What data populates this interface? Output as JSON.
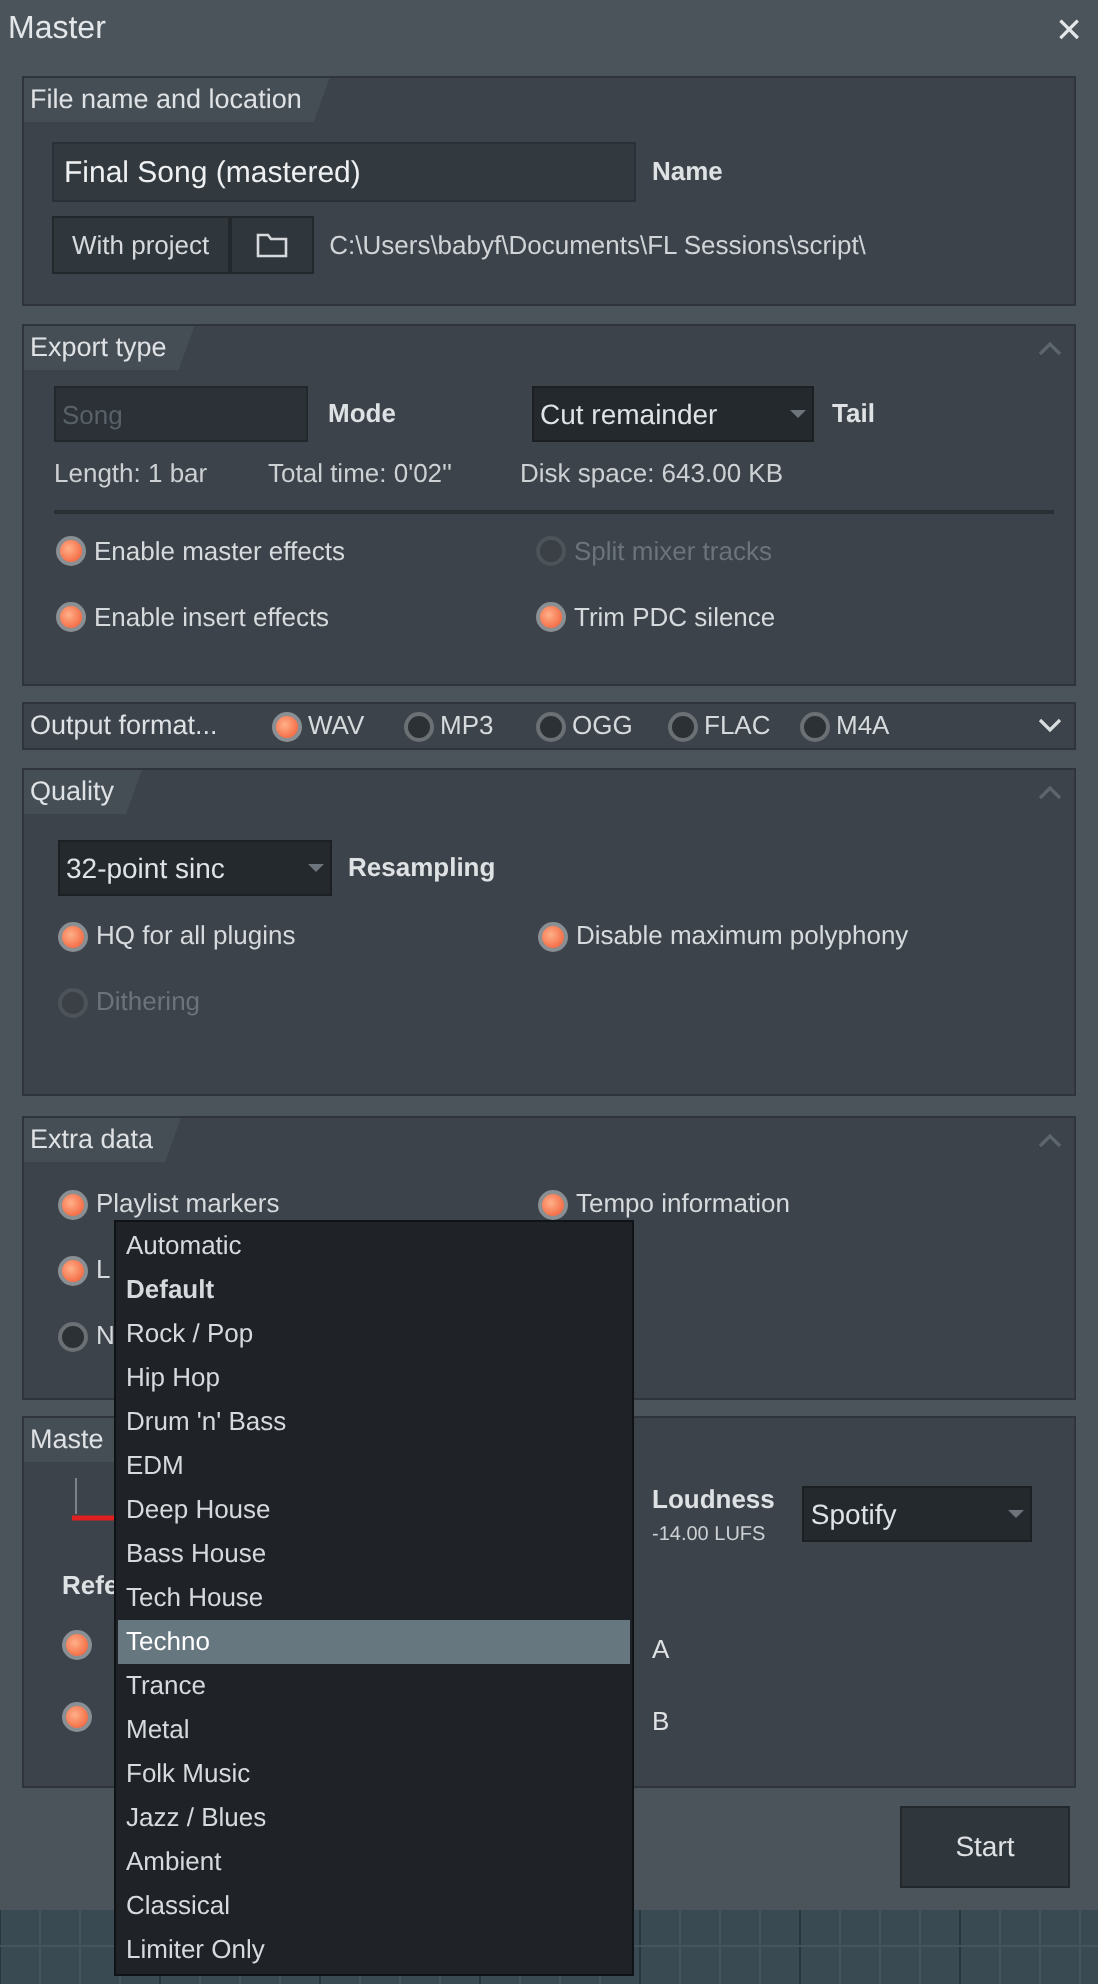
{
  "window": {
    "title": "Master",
    "close": "×"
  },
  "file_location": {
    "title": "File name and location",
    "name_value": "Final Song (mastered)",
    "name_label": "Name",
    "with_project": "With project",
    "path": "C:\\Users\\babyf\\Documents\\FL Sessions\\script\\"
  },
  "export_type": {
    "title": "Export type",
    "expanded": true,
    "mode_value": "Song",
    "mode_disabled": true,
    "mode_label": "Mode",
    "tail_value": "Cut remainder",
    "tail_label": "Tail",
    "stats": [
      "Length: 1 bar",
      "Total time: 0'02''",
      "Disk space: 643.00 KB"
    ],
    "rows": [
      [
        {
          "label": "Enable master effects",
          "checked": true,
          "disabled": false
        },
        {
          "label": "Split mixer tracks",
          "checked": false,
          "disabled": true
        }
      ],
      [
        {
          "label": "Enable insert effects",
          "checked": true,
          "disabled": false
        },
        {
          "label": "Trim PDC silence",
          "checked": true,
          "disabled": false
        }
      ]
    ]
  },
  "output_format": {
    "title": "Output format...",
    "expanded": false,
    "options": [
      {
        "label": "WAV",
        "selected": true
      },
      {
        "label": "MP3",
        "selected": false
      },
      {
        "label": "OGG",
        "selected": false
      },
      {
        "label": "FLAC",
        "selected": false
      },
      {
        "label": "M4A",
        "selected": false
      }
    ]
  },
  "quality": {
    "title": "Quality",
    "expanded": true,
    "resampling_value": "32-point sinc",
    "resampling_label": "Resampling",
    "rows": [
      [
        {
          "label": "HQ for all plugins",
          "checked": true,
          "disabled": false
        },
        {
          "label": "Disable maximum polyphony",
          "checked": true,
          "disabled": false
        }
      ],
      [
        {
          "label": "Dithering",
          "checked": false,
          "disabled": true
        }
      ]
    ]
  },
  "extra_data": {
    "title": "Extra data",
    "expanded": true,
    "rows": [
      [
        {
          "label": "Playlist markers",
          "checked": true,
          "disabled": false
        },
        {
          "label": "Tempo information",
          "checked": true,
          "disabled": false
        }
      ],
      [
        {
          "label": "L",
          "checked": true,
          "disabled": false
        }
      ],
      [
        {
          "label": "N",
          "checked": false,
          "disabled": false
        }
      ]
    ]
  },
  "mastering": {
    "title": "Maste",
    "loudness_label": "Loudness",
    "loudness_value": "-14.00 LUFS",
    "platform": "Spotify",
    "reference_label": "Refe",
    "references": [
      {
        "label": "A",
        "checked": true
      },
      {
        "label": "B",
        "checked": true
      }
    ]
  },
  "start_button": "Start",
  "preset_menu": {
    "items": [
      {
        "label": "Automatic",
        "kind": "normal",
        "selected": false
      },
      {
        "label": "Default",
        "kind": "default",
        "selected": false
      },
      {
        "label": "Rock / Pop",
        "kind": "normal",
        "selected": false
      },
      {
        "label": "Hip Hop",
        "kind": "normal",
        "selected": false
      },
      {
        "label": "Drum 'n' Bass",
        "kind": "normal",
        "selected": false
      },
      {
        "label": "EDM",
        "kind": "normal",
        "selected": false
      },
      {
        "label": "Deep House",
        "kind": "normal",
        "selected": false
      },
      {
        "label": "Bass House",
        "kind": "normal",
        "selected": false
      },
      {
        "label": "Tech House",
        "kind": "normal",
        "selected": false
      },
      {
        "label": "Techno",
        "kind": "normal",
        "selected": true
      },
      {
        "label": "Trance",
        "kind": "normal",
        "selected": false
      },
      {
        "label": "Metal",
        "kind": "normal",
        "selected": false
      },
      {
        "label": "Folk Music",
        "kind": "normal",
        "selected": false
      },
      {
        "label": "Jazz / Blues",
        "kind": "normal",
        "selected": false
      },
      {
        "label": "Ambient",
        "kind": "normal",
        "selected": false
      },
      {
        "label": "Classical",
        "kind": "normal",
        "selected": false
      },
      {
        "label": "Limiter Only",
        "kind": "normal",
        "selected": false
      }
    ]
  }
}
